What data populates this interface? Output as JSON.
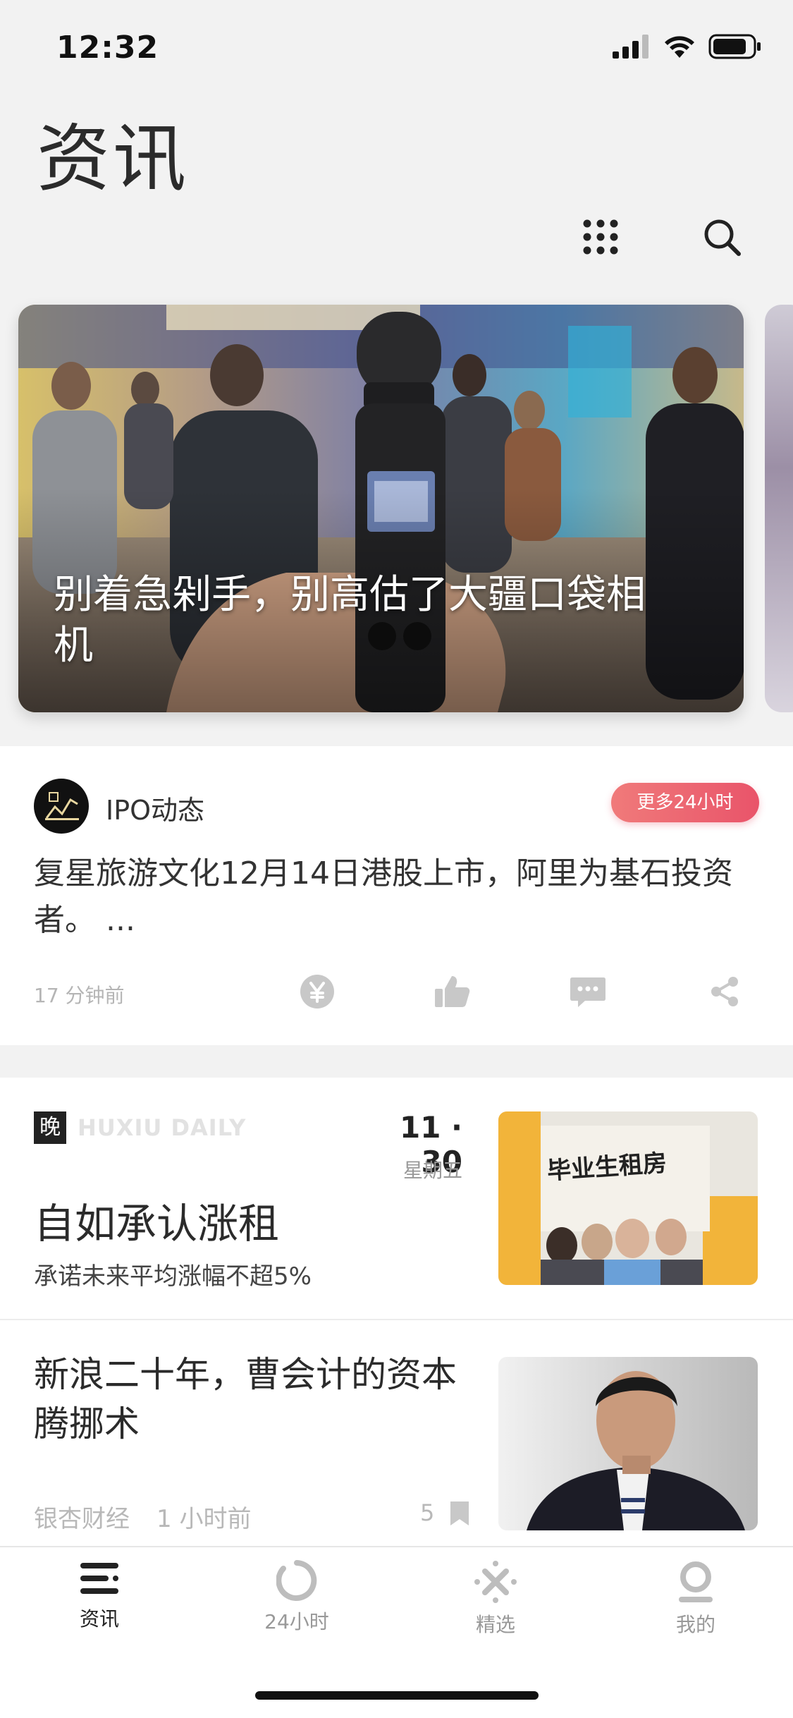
{
  "status_bar": {
    "time": "12:32"
  },
  "header": {
    "title": "资讯"
  },
  "hero": {
    "title": "别着急剁手，别高估了大疆口袋相机"
  },
  "flash": {
    "name": "IPO动态",
    "more_label": "更多24小时",
    "text": "复星旅游文化12月14日港股上市，阿里为基石投资者。 ...",
    "time": "17 分钟前"
  },
  "daily": {
    "badge": "晚",
    "brand": "HUXIU DAILY",
    "date": "11 · 30",
    "weekday": "星期五",
    "title": "自如承认涨租",
    "subtitle": "承诺未来平均涨幅不超5%",
    "thumb_text": "毕业生租房"
  },
  "article": {
    "title": "新浪二十年，曹会计的资本腾挪术",
    "source": "银杏财经",
    "time": "1 小时前",
    "count": "5"
  },
  "tabs": [
    {
      "label": "资讯",
      "icon": "news-icon",
      "active": true
    },
    {
      "label": "24小时",
      "icon": "clock-ring-icon",
      "active": false
    },
    {
      "label": "精选",
      "icon": "sparkle-icon",
      "active": false
    },
    {
      "label": "我的",
      "icon": "profile-icon",
      "active": false
    }
  ],
  "colors": {
    "accent": "#e9546a",
    "background": "#f2f2f2",
    "text": "#222222",
    "muted": "#b5b5b5"
  }
}
